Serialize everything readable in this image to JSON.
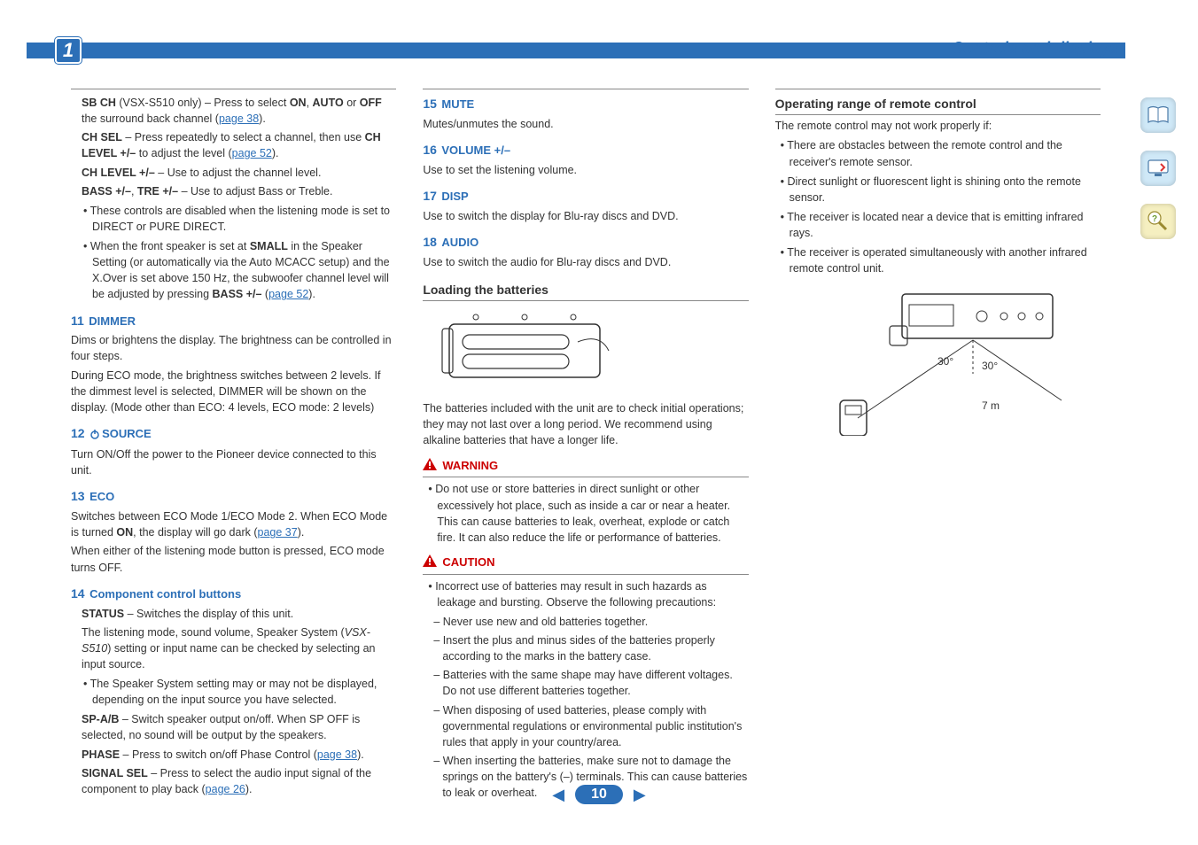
{
  "header": {
    "chapter_number": "1",
    "chapter_title": "Controls and displays"
  },
  "col1": {
    "sbch_intro1": "SB CH",
    "sbch_intro2": " (VSX-S510 only) – Press to select ",
    "sbch_on": "ON",
    "sbch_sep": ", ",
    "sbch_auto": "AUTO",
    "sbch_or": " or ",
    "sbch_off": "OFF",
    "sbch_tail": " the surround back channel (",
    "sbch_link": "page 38",
    "sbch_close": ").",
    "chsel_b": "CH SEL",
    "chsel_txt": " – Press repeatedly to select a channel, then use ",
    "chlevel_b": "CH LEVEL +/–",
    "chlevel_txt": " to adjust the level (",
    "chlevel_link": "page 52",
    "chlevel_close": ").",
    "chlvl2_b": "CH LEVEL +/–",
    "chlvl2_txt": " – Use to adjust the channel level.",
    "bass_b": "BASS +/–",
    "bass_sep": ", ",
    "tre_b": "TRE +/–",
    "bass_txt": " – Use to adjust Bass or Treble.",
    "bass_bullet1": "These controls are disabled when the listening mode is set to DIRECT or PURE DIRECT.",
    "bass_bullet2a": "When the front speaker is set at ",
    "bass_small": "SMALL",
    "bass_bullet2b": " in the Speaker Setting (or automatically via the Auto MCACC setup) and the X.Over is set above 150 Hz, the subwoofer channel level will be adjusted by pressing ",
    "bass_bassb": "BASS +/–",
    "bass_bullet2c": " (",
    "bass_link": "page 52",
    "bass_bullet2d": ").",
    "h11_num": "11",
    "h11_lbl": "DIMMER",
    "h11_p1": "Dims or brightens the display. The brightness can be controlled in four steps.",
    "h11_p2": "During ECO mode, the brightness switches between 2 levels. If the dimmest level is selected, DIMMER will be shown on the display. (Mode other than ECO: 4 levels, ECO mode: 2 levels)",
    "h12_num": "12",
    "h12_lbl": "SOURCE",
    "h12_p": "Turn ON/Off the power to the Pioneer device connected to this unit.",
    "h13_num": "13",
    "h13_lbl": "ECO",
    "h13_p1a": "Switches between ECO Mode 1/ECO Mode 2. When ECO Mode is turned ",
    "h13_on": "ON",
    "h13_p1b": ", the display will go dark (",
    "h13_link": "page 37",
    "h13_p1c": ").",
    "h13_p2": "When either of the listening mode button is pressed, ECO mode turns OFF.",
    "h14_num": "14",
    "h14_lbl": "Component control buttons",
    "h14_status_b": "STATUS",
    "h14_status_txt": " – Switches the display of this unit.",
    "h14_status_p2a": "The listening mode, sound volume, Speaker System (",
    "h14_status_em": "VSX-S510",
    "h14_status_p2b": ") setting or input name can be checked by selecting an input source.",
    "h14_status_bullet": "The Speaker System setting may or may not be displayed, depending on the input source you have selected.",
    "h14_spab_b": "SP-A/B",
    "h14_spab_txt": " – Switch speaker output on/off. When SP OFF is selected, no sound will be output by the speakers.",
    "h14_phase_b": "PHASE",
    "h14_phase_txt": " – Press to switch on/off Phase Control (",
    "h14_phase_link": "page 38",
    "h14_phase_close": ").",
    "h14_sig_b": "SIGNAL SEL",
    "h14_sig_txt": " – Press to select the audio input signal of the component to play back (",
    "h14_sig_link": "page 26",
    "h14_sig_close": ")."
  },
  "col2": {
    "h15_num": "15",
    "h15_lbl": "MUTE",
    "h15_p": "Mutes/unmutes the sound.",
    "h16_num": "16",
    "h16_lbl": "VOLUME +/–",
    "h16_p": "Use to set the listening volume.",
    "h17_num": "17",
    "h17_lbl": "DISP",
    "h17_p": "Use to switch the display for Blu-ray discs and DVD.",
    "h18_num": "18",
    "h18_lbl": "AUDIO",
    "h18_p": "Use to switch the audio for Blu-ray discs and DVD.",
    "h_batteries": "Loading the batteries",
    "batt_caption": "The batteries included with the unit are to check initial operations; they may not last over a long period. We recommend using alkaline batteries that have a longer life.",
    "warn_label": "WARNING",
    "warn_bullet": "Do not use or store batteries in direct sunlight or other excessively hot place, such as inside a car or near a heater. This can cause batteries to leak, overheat, explode or catch fire. It can also reduce the life or performance of batteries.",
    "caution_label": "CAUTION",
    "caution_bullet": "Incorrect use of batteries may result in such hazards as leakage and bursting. Observe the following precautions:",
    "caution_d1": "Never use new and old batteries together.",
    "caution_d2": "Insert the plus and minus sides of the batteries properly according to the marks in the battery case.",
    "caution_d3": "Batteries with the same shape may have different voltages. Do not use different batteries together.",
    "caution_d4": "When disposing of used batteries, please comply with governmental regulations or environmental public institution's rules that apply in your country/area.",
    "caution_d5": "When inserting the batteries, make sure not to damage the springs on the battery's (–) terminals. This can cause batteries to leak or overheat."
  },
  "col3": {
    "h_range": "Operating range of remote control",
    "range_intro": "The remote control may not work properly if:",
    "range_b1": "There are obstacles between the remote control and the receiver's remote sensor.",
    "range_b2": "Direct sunlight or fluorescent light is shining onto the remote sensor.",
    "range_b3": "The receiver is located near a device that is emitting infrared rays.",
    "range_b4": "The receiver is operated simultaneously with another infrared remote control unit.",
    "fig_30a": "30°",
    "fig_30b": "30°",
    "fig_7m": "7 m"
  },
  "footer": {
    "page_number": "10"
  }
}
